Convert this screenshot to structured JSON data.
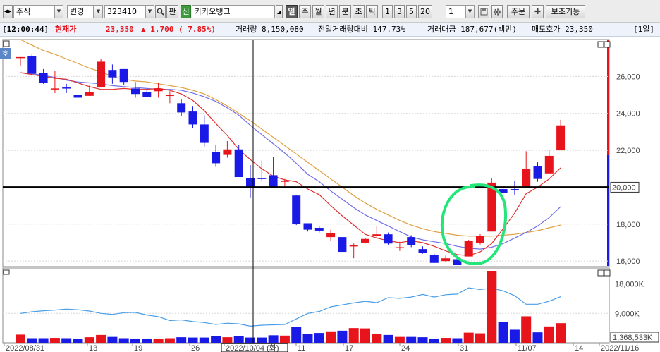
{
  "toolbar": {
    "market_label": "주식",
    "change_label": "변경",
    "code": "323410",
    "pan_label": "판",
    "new_badge": "신",
    "stock_name": "카카오뱅크",
    "period_buttons": [
      "일",
      "주",
      "월",
      "년",
      "분",
      "초",
      "틱"
    ],
    "interval_buttons": [
      "1",
      "3",
      "5",
      "20"
    ],
    "count_value": "1",
    "order_button": "주문",
    "aux_button": "보조기능"
  },
  "infobar": {
    "time": "[12:00:44]",
    "price_label": "현재가",
    "price": "23,350",
    "change": "▲  1,700 ( 7.85%)",
    "volume": "거래량 8,150,080",
    "prev_volume_ratio": "전일거래량대비 147.73%",
    "amount": "거래대금 187,677(백만)",
    "ask": "매도호가 23,350",
    "period": "[1일]"
  },
  "colors": {
    "up": "#e8141b",
    "down": "#1a1ae6",
    "ma5": "#e03030",
    "ma10": "#7070e8",
    "ma20": "#e0a040",
    "vol_ma": "#4a9ee8",
    "highlight": "#22e67a"
  },
  "chart_data": {
    "type": "candlestick",
    "x_labels": [
      "2022/08/31",
      "13",
      "19",
      "26",
      "2022/10/04 (화)",
      "11",
      "17",
      "24",
      "31",
      "11/07",
      "14",
      "2022/11/16"
    ],
    "ylim": [
      15700,
      28000
    ],
    "yticks": [
      "26,000",
      "24,000",
      "22,000",
      "20,000",
      "18,000",
      "16,000"
    ],
    "yticks_values": [
      26000,
      24000,
      22000,
      20000,
      18000,
      16000
    ],
    "horizontal_line": {
      "value": 20000,
      "label": "20,000"
    },
    "candles": [
      {
        "o": 27050,
        "h": 27050,
        "l": 26550,
        "c": 27050
      },
      {
        "o": 27100,
        "h": 27200,
        "l": 26100,
        "c": 26150
      },
      {
        "o": 26200,
        "h": 26400,
        "l": 25600,
        "c": 25650
      },
      {
        "o": 25350,
        "h": 26300,
        "l": 25100,
        "c": 25350
      },
      {
        "o": 25400,
        "h": 25600,
        "l": 25100,
        "c": 25350
      },
      {
        "o": 25000,
        "h": 25400,
        "l": 24850,
        "c": 24850
      },
      {
        "o": 24950,
        "h": 25500,
        "l": 24950,
        "c": 25150
      },
      {
        "o": 25400,
        "h": 26950,
        "l": 25400,
        "c": 26800
      },
      {
        "o": 26350,
        "h": 26650,
        "l": 25600,
        "c": 25950
      },
      {
        "o": 26400,
        "h": 26400,
        "l": 25550,
        "c": 25700
      },
      {
        "o": 25350,
        "h": 25700,
        "l": 24850,
        "c": 25050
      },
      {
        "o": 25150,
        "h": 25300,
        "l": 24900,
        "c": 24900
      },
      {
        "o": 25200,
        "h": 25650,
        "l": 24850,
        "c": 25350
      },
      {
        "o": 24950,
        "h": 25200,
        "l": 24550,
        "c": 25000
      },
      {
        "o": 24550,
        "h": 24750,
        "l": 23850,
        "c": 24050
      },
      {
        "o": 24100,
        "h": 24400,
        "l": 23200,
        "c": 23400
      },
      {
        "o": 23400,
        "h": 23900,
        "l": 22200,
        "c": 22400
      },
      {
        "o": 21900,
        "h": 22300,
        "l": 21100,
        "c": 21300
      },
      {
        "o": 21750,
        "h": 22500,
        "l": 21600,
        "c": 22050
      },
      {
        "o": 22050,
        "h": 22300,
        "l": 20550,
        "c": 20550
      },
      {
        "o": 20500,
        "h": 21200,
        "l": 19450,
        "c": 19950
      },
      {
        "o": 20500,
        "h": 21450,
        "l": 20300,
        "c": 20450
      },
      {
        "o": 20650,
        "h": 21650,
        "l": 20100,
        "c": 20000
      },
      {
        "o": 20350,
        "h": 20450,
        "l": 20050,
        "c": 20350
      },
      {
        "o": 19550,
        "h": 19600,
        "l": 17950,
        "c": 18000
      },
      {
        "o": 18050,
        "h": 18050,
        "l": 17600,
        "c": 17700
      },
      {
        "o": 17800,
        "h": 17900,
        "l": 17550,
        "c": 17650
      },
      {
        "o": 17300,
        "h": 17700,
        "l": 17100,
        "c": 17500
      },
      {
        "o": 17300,
        "h": 17300,
        "l": 16500,
        "c": 16500
      },
      {
        "o": 16800,
        "h": 16950,
        "l": 16150,
        "c": 16850
      },
      {
        "o": 17000,
        "h": 17250,
        "l": 16950,
        "c": 17200
      },
      {
        "o": 17350,
        "h": 17900,
        "l": 17250,
        "c": 17450
      },
      {
        "o": 17450,
        "h": 17550,
        "l": 16850,
        "c": 16950
      },
      {
        "o": 16700,
        "h": 17050,
        "l": 16550,
        "c": 16750
      },
      {
        "o": 17300,
        "h": 17400,
        "l": 16750,
        "c": 16850
      },
      {
        "o": 16650,
        "h": 16800,
        "l": 16400,
        "c": 16450
      },
      {
        "o": 16350,
        "h": 16400,
        "l": 15900,
        "c": 15900
      },
      {
        "o": 16000,
        "h": 16300,
        "l": 15950,
        "c": 16150
      },
      {
        "o": 16100,
        "h": 16100,
        "l": 15800,
        "c": 15800
      },
      {
        "o": 16250,
        "h": 17150,
        "l": 16250,
        "c": 17100
      },
      {
        "o": 17000,
        "h": 17450,
        "l": 16900,
        "c": 17350
      },
      {
        "o": 17600,
        "h": 20500,
        "l": 17600,
        "c": 20250
      },
      {
        "o": 19900,
        "h": 20050,
        "l": 19550,
        "c": 19700
      },
      {
        "o": 19900,
        "h": 20350,
        "l": 19600,
        "c": 19850
      },
      {
        "o": 20000,
        "h": 21950,
        "l": 20000,
        "c": 21000
      },
      {
        "o": 21150,
        "h": 21350,
        "l": 20300,
        "c": 20450
      },
      {
        "o": 20750,
        "h": 22000,
        "l": 20750,
        "c": 21700
      },
      {
        "o": 22000,
        "h": 23650,
        "l": 22000,
        "c": 23350
      }
    ],
    "ma5": [
      26200,
      26100,
      26000,
      25900,
      25850,
      25650,
      25450,
      25300,
      25300,
      25350,
      25300,
      25300,
      25350,
      25250,
      25050,
      24700,
      24150,
      23450,
      22800,
      22050,
      21500,
      21000,
      20600,
      20400,
      20300,
      19900,
      19600,
      19000,
      18450,
      17950,
      17450,
      17250,
      17100,
      17000,
      17100,
      17000,
      16800,
      16550,
      16350,
      16300,
      16500,
      16950,
      17750,
      18600,
      19650,
      20000,
      20450,
      21050
    ],
    "ma10": [
      26200,
      26150,
      26050,
      25950,
      25800,
      25700,
      25650,
      25600,
      25500,
      25450,
      25400,
      25350,
      25300,
      25300,
      25250,
      25100,
      24900,
      24650,
      24300,
      23900,
      23350,
      22850,
      22350,
      21850,
      21300,
      20700,
      20300,
      19800,
      19350,
      18900,
      18500,
      18200,
      17900,
      17600,
      17300,
      17150,
      17050,
      16950,
      16800,
      16700,
      16650,
      16750,
      16950,
      17250,
      17550,
      17900,
      18350,
      18950
    ],
    "ma20": [
      28000,
      27700,
      27400,
      27200,
      26950,
      26700,
      26450,
      26250,
      26000,
      25850,
      25750,
      25700,
      25600,
      25500,
      25400,
      25250,
      25050,
      24750,
      24400,
      24000,
      23600,
      23150,
      22700,
      22250,
      21800,
      21350,
      20900,
      20450,
      20000,
      19550,
      19150,
      18800,
      18500,
      18200,
      17950,
      17750,
      17600,
      17500,
      17400,
      17350,
      17350,
      17350,
      17400,
      17450,
      17550,
      17650,
      17800,
      17950
    ],
    "volume_ylim": [
      0,
      22000
    ],
    "volume_ticks": [
      "18,000K",
      "9,000K"
    ],
    "volume_ticks_values": [
      18000,
      9000
    ],
    "volume_last_label": "1,368,533K",
    "volume": [
      2500,
      1400,
      1400,
      1500,
      1400,
      1200,
      1700,
      2400,
      1800,
      1400,
      1300,
      1300,
      1300,
      1400,
      1700,
      1600,
      1600,
      2100,
      1700,
      2100,
      1600,
      1600,
      2300,
      2200,
      4800,
      2700,
      3000,
      3500,
      3700,
      4500,
      4400,
      2600,
      2400,
      1800,
      1800,
      1700,
      1300,
      1500,
      1400,
      3100,
      2900,
      22000,
      6300,
      4000,
      8100,
      3200,
      5000,
      6000
    ],
    "vol_ma": [
      9000,
      9500,
      9800,
      10000,
      10300,
      10100,
      9700,
      9000,
      8700,
      9200,
      9300,
      8500,
      8000,
      6800,
      7000,
      6500,
      6200,
      5600,
      6000,
      5800,
      5100,
      5400,
      5500,
      5600,
      7300,
      9000,
      9600,
      11000,
      11600,
      12200,
      12700,
      12300,
      13800,
      13600,
      14000,
      14800,
      14000,
      14700,
      14900,
      16800,
      16300,
      16700,
      15900,
      14400,
      11800,
      11800,
      12700,
      14100
    ]
  }
}
